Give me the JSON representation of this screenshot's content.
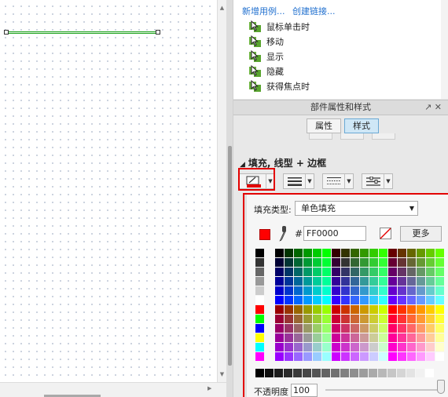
{
  "interactions": {
    "links": [
      "新增用例...",
      "创建链接..."
    ],
    "events": [
      "鼠标单击时",
      "移动",
      "显示",
      "隐藏",
      "获得焦点时"
    ]
  },
  "props_panel": {
    "title": "部件属性和样式",
    "tab_properties": "属性",
    "tab_style": "样式"
  },
  "section": {
    "title": "填充, 线型 + 边框"
  },
  "color_picker": {
    "fill_type_label": "填充类型:",
    "fill_type_value": "单色填充",
    "hash": "#",
    "hex_value": "FF0000",
    "current_color": "#ff0000",
    "more_label": "更多",
    "opacity_label": "不透明度",
    "opacity_value": "100"
  },
  "icons": {
    "fill": "paint-bucket-icon",
    "eyedropper": "eyedropper-icon",
    "no_color": "no-color-icon",
    "event": "cursor-event-icon"
  },
  "colors": {
    "accent_red": "#e30000",
    "link_blue": "#1f6fcf",
    "tab_selected": "#cfe7f6",
    "selection_green": "#1ea11e"
  }
}
